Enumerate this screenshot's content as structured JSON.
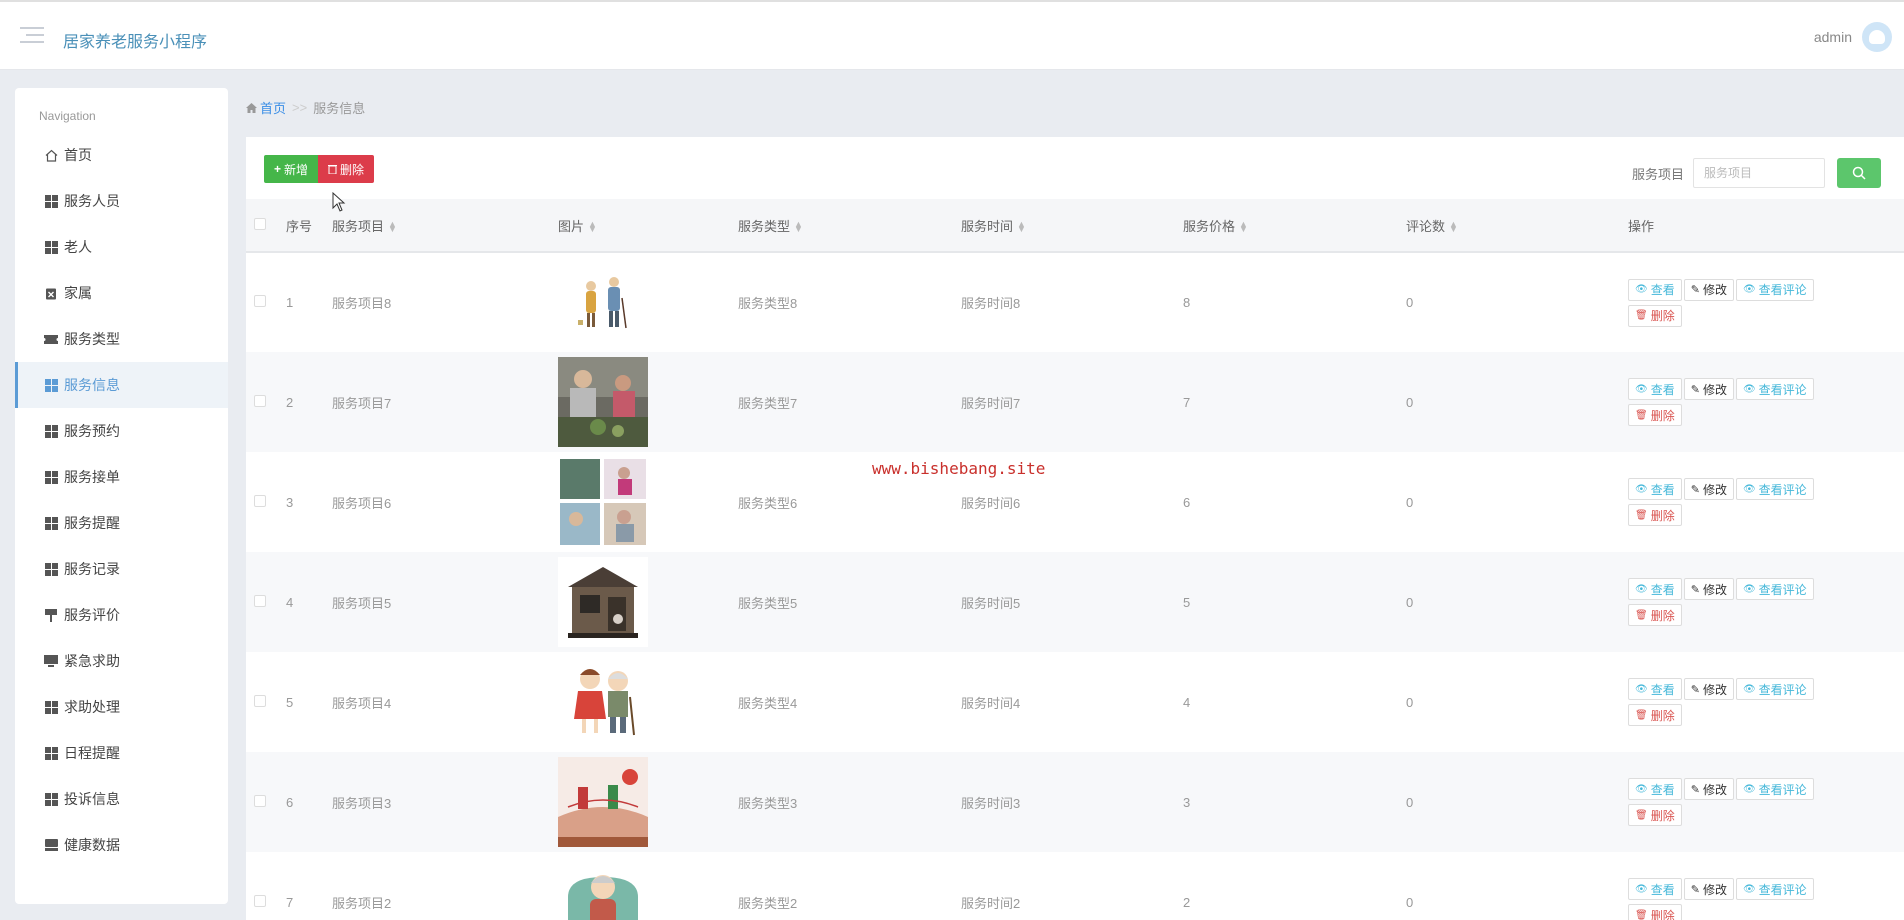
{
  "header": {
    "app_title": "居家养老服务小程序",
    "user_name": "admin"
  },
  "sidebar": {
    "nav_title": "Navigation",
    "items": [
      {
        "label": "首页",
        "icon": "home-icon"
      },
      {
        "label": "服务人员",
        "icon": "grid-icon"
      },
      {
        "label": "老人",
        "icon": "grid-icon"
      },
      {
        "label": "家属",
        "icon": "clipboard-icon"
      },
      {
        "label": "服务类型",
        "icon": "ticket-icon"
      },
      {
        "label": "服务信息",
        "icon": "grid-icon",
        "active": true
      },
      {
        "label": "服务预约",
        "icon": "grid-icon"
      },
      {
        "label": "服务接单",
        "icon": "grid-icon"
      },
      {
        "label": "服务提醒",
        "icon": "grid-icon"
      },
      {
        "label": "服务记录",
        "icon": "grid-icon"
      },
      {
        "label": "服务评价",
        "icon": "signpost-icon"
      },
      {
        "label": "紧急求助",
        "icon": "monitor-icon"
      },
      {
        "label": "求助处理",
        "icon": "grid-icon"
      },
      {
        "label": "日程提醒",
        "icon": "grid-icon"
      },
      {
        "label": "投诉信息",
        "icon": "grid-icon"
      },
      {
        "label": "健康数据",
        "icon": "drive-icon"
      }
    ]
  },
  "breadcrumb": {
    "home": "首页",
    "separator": ">>",
    "current": "服务信息"
  },
  "toolbar": {
    "add_label": "新增",
    "delete_label": "删除",
    "search_label": "服务项目",
    "search_placeholder": "服务项目"
  },
  "table": {
    "headers": {
      "index": "序号",
      "item": "服务项目",
      "image": "图片",
      "type": "服务类型",
      "time": "服务时间",
      "price": "服务价格",
      "comments": "评论数",
      "actions": "操作"
    },
    "actions": {
      "view": "查看",
      "edit": "修改",
      "view_comments": "查看评论",
      "delete": "删除"
    },
    "rows": [
      {
        "index": "1",
        "item": "服务项目8",
        "type": "服务类型8",
        "time": "服务时间8",
        "price": "8",
        "comments": "0",
        "image_icon": "elderly-couple-image"
      },
      {
        "index": "2",
        "item": "服务项目7",
        "type": "服务类型7",
        "time": "服务时间7",
        "price": "7",
        "comments": "0",
        "image_icon": "cooking-photo-image"
      },
      {
        "index": "3",
        "item": "服务项目6",
        "type": "服务类型6",
        "time": "服务时间6",
        "price": "6",
        "comments": "0",
        "image_icon": "care-collage-image"
      },
      {
        "index": "4",
        "item": "服务项目5",
        "type": "服务类型5",
        "time": "服务时间5",
        "price": "5",
        "comments": "0",
        "image_icon": "house-model-image"
      },
      {
        "index": "5",
        "item": "服务项目4",
        "type": "服务类型4",
        "time": "服务时间4",
        "price": "4",
        "comments": "0",
        "image_icon": "cartoon-couple-image"
      },
      {
        "index": "6",
        "item": "服务项目3",
        "type": "服务类型3",
        "time": "服务时间3",
        "price": "3",
        "comments": "0",
        "image_icon": "festival-card-image"
      },
      {
        "index": "7",
        "item": "服务项目2",
        "type": "服务类型2",
        "time": "服务时间2",
        "price": "2",
        "comments": "0",
        "image_icon": "grandma-image"
      }
    ]
  },
  "watermark": "www.bishebang.site"
}
